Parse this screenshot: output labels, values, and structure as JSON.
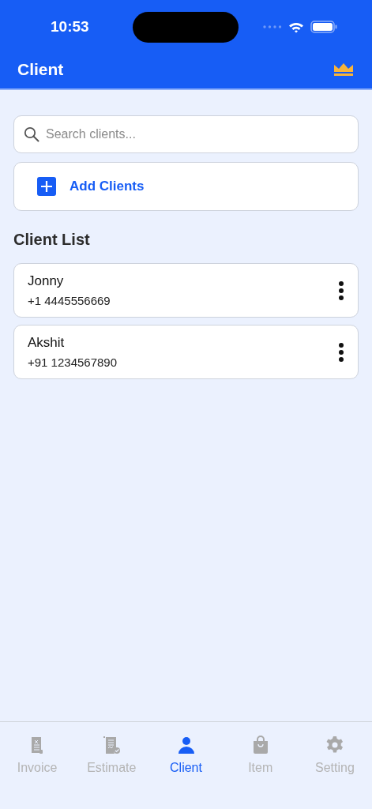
{
  "status_bar": {
    "time": "10:53"
  },
  "header": {
    "title": "Client"
  },
  "search": {
    "placeholder": "Search clients..."
  },
  "add_button": {
    "label": "Add Clients"
  },
  "section_title": "Client List",
  "clients": [
    {
      "name": "Jonny",
      "phone": "+1 4445556669"
    },
    {
      "name": "Akshit",
      "phone": "+91 1234567890"
    }
  ],
  "tabs": [
    {
      "label": "Invoice",
      "kind": "invoice",
      "selected": false
    },
    {
      "label": "Estimate",
      "kind": "estimate",
      "selected": false
    },
    {
      "label": "Client",
      "kind": "client",
      "selected": true
    },
    {
      "label": "Item",
      "kind": "item",
      "selected": false
    },
    {
      "label": "Setting",
      "kind": "setting",
      "selected": false
    }
  ]
}
